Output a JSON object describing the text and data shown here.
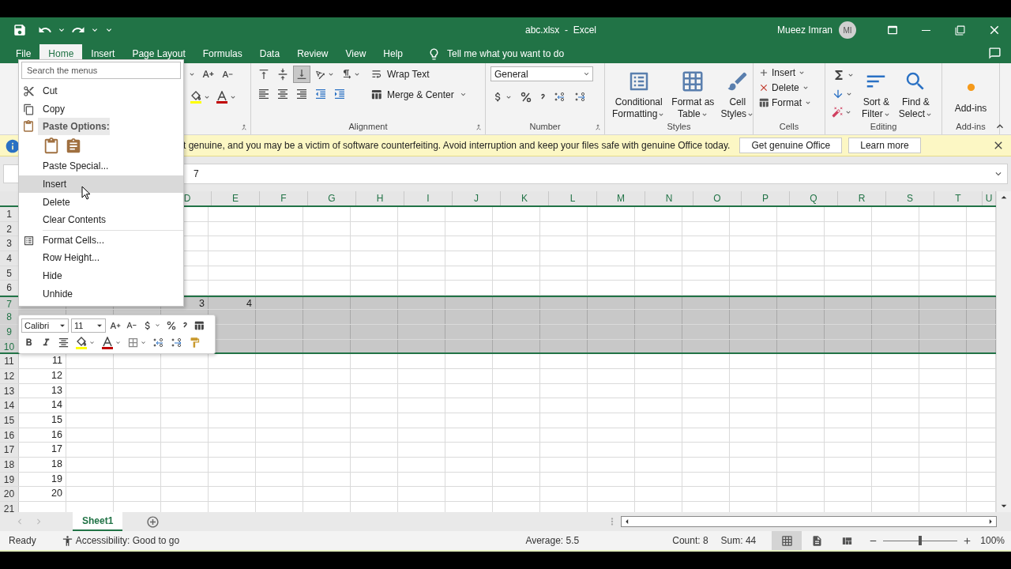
{
  "title_bar": {
    "title": "abc.xlsx  -  Excel",
    "user": "Mueez Imran",
    "avatar": "MI"
  },
  "ribbon_tabs": [
    {
      "label": "File",
      "selected": false
    },
    {
      "label": "Home",
      "selected": true
    },
    {
      "label": "Insert",
      "selected": false
    },
    {
      "label": "Page Layout",
      "selected": false
    },
    {
      "label": "Formulas",
      "selected": false
    },
    {
      "label": "Data",
      "selected": false
    },
    {
      "label": "Review",
      "selected": false
    },
    {
      "label": "View",
      "selected": false
    },
    {
      "label": "Help",
      "selected": false
    }
  ],
  "tell_me": "Tell me what you want to do",
  "ribbon": {
    "alignment": {
      "label": "Alignment",
      "wrap_text": "Wrap Text",
      "merge": "Merge & Center",
      "vertical_align": [
        {
          "selected": false
        },
        {
          "selected": false
        },
        {
          "selected": true
        }
      ]
    },
    "number": {
      "label": "Number",
      "format": "General"
    },
    "styles": {
      "label": "Styles",
      "buttons": [
        {
          "lines": [
            "Conditional",
            "Formatting"
          ]
        },
        {
          "lines": [
            "Format as",
            "Table"
          ]
        },
        {
          "lines": [
            "Cell",
            "Styles"
          ]
        }
      ]
    },
    "cells": {
      "label": "Cells",
      "buttons": [
        "Insert",
        "Delete",
        "Format"
      ]
    },
    "editing": {
      "label": "Editing",
      "buttons": [
        {
          "lines": [
            "Sort &",
            "Filter"
          ]
        },
        {
          "lines": [
            "Find &",
            "Select"
          ]
        }
      ]
    },
    "add_ins": {
      "label": "Add-ins",
      "button": "Add-ins"
    }
  },
  "message_bar": {
    "text": "t genuine, and you may be a victim of software counterfeiting. Avoid interruption and keep your files safe with genuine Office today.",
    "buttons": [
      "Get genuine Office",
      "Learn more"
    ]
  },
  "formula_bar": {
    "value": "7"
  },
  "grid": {
    "columns": [
      "D",
      "E",
      "F",
      "G",
      "H",
      "I",
      "J",
      "K",
      "L",
      "M",
      "N",
      "O",
      "P",
      "Q",
      "R",
      "S",
      "T",
      "U"
    ],
    "rows": [
      {
        "header": "1",
        "selected": false,
        "cells": {}
      },
      {
        "header": "2",
        "selected": false,
        "cells": {}
      },
      {
        "header": "3",
        "selected": false,
        "cells": {}
      },
      {
        "header": "4",
        "selected": false,
        "cells": {}
      },
      {
        "header": "5",
        "selected": false,
        "cells": {}
      },
      {
        "header": "6",
        "selected": false,
        "cells": {}
      },
      {
        "header": "7",
        "selected": true,
        "cells": {
          "D": "3",
          "E": "4"
        }
      },
      {
        "header": "8",
        "selected": true,
        "cells": {}
      },
      {
        "header": "9",
        "selected": true,
        "cells": {}
      },
      {
        "header": "10",
        "selected": true,
        "cells": {}
      },
      {
        "header": "11",
        "selected": false,
        "cells": {
          "A": "11"
        }
      },
      {
        "header": "12",
        "selected": false,
        "cells": {
          "A": "12"
        }
      },
      {
        "header": "13",
        "selected": false,
        "cells": {
          "A": "13"
        }
      },
      {
        "header": "14",
        "selected": false,
        "cells": {
          "A": "14"
        }
      },
      {
        "header": "15",
        "selected": false,
        "cells": {
          "A": "15"
        }
      },
      {
        "header": "16",
        "selected": false,
        "cells": {
          "A": "16"
        }
      },
      {
        "header": "17",
        "selected": false,
        "cells": {
          "A": "17"
        }
      },
      {
        "header": "18",
        "selected": false,
        "cells": {
          "A": "18"
        }
      },
      {
        "header": "19",
        "selected": false,
        "cells": {
          "A": "19"
        }
      },
      {
        "header": "20",
        "selected": false,
        "cells": {
          "A": "20"
        }
      },
      {
        "header": "21",
        "selected": false,
        "cells": {}
      }
    ]
  },
  "sheet_tabs": [
    {
      "label": "Sheet1",
      "selected": true
    }
  ],
  "status_bar": {
    "mode": "Ready",
    "accessibility": "Accessibility: Good to go",
    "stats": [
      "Average: 5.5",
      "Count: 8",
      "Sum: 44"
    ],
    "views": [
      {
        "selected": true
      },
      {
        "selected": false
      },
      {
        "selected": false
      }
    ],
    "zoom": {
      "level": 0.5,
      "reading": "100%"
    }
  },
  "context_menu": {
    "search_placeholder": "Search the menus",
    "items": [
      {
        "kind": "command",
        "label": "Cut",
        "selected": false
      },
      {
        "kind": "command",
        "label": "Copy",
        "selected": false
      },
      {
        "kind": "header",
        "label": "Paste Options:"
      },
      {
        "kind": "paste-icons"
      },
      {
        "kind": "command",
        "label": "Paste Special...",
        "selected": false
      },
      {
        "kind": "command",
        "label": "Insert",
        "selected": true
      },
      {
        "kind": "command",
        "label": "Delete",
        "selected": false
      },
      {
        "kind": "command",
        "label": "Clear Contents",
        "selected": false
      },
      {
        "kind": "separator"
      },
      {
        "kind": "command",
        "label": "Format Cells...",
        "selected": false
      },
      {
        "kind": "command",
        "label": "Row Height...",
        "selected": false
      },
      {
        "kind": "command",
        "label": "Hide",
        "selected": false
      },
      {
        "kind": "command",
        "label": "Unhide",
        "selected": false
      }
    ]
  },
  "mini_toolbar": {
    "font": "Calibri",
    "size": "11"
  }
}
